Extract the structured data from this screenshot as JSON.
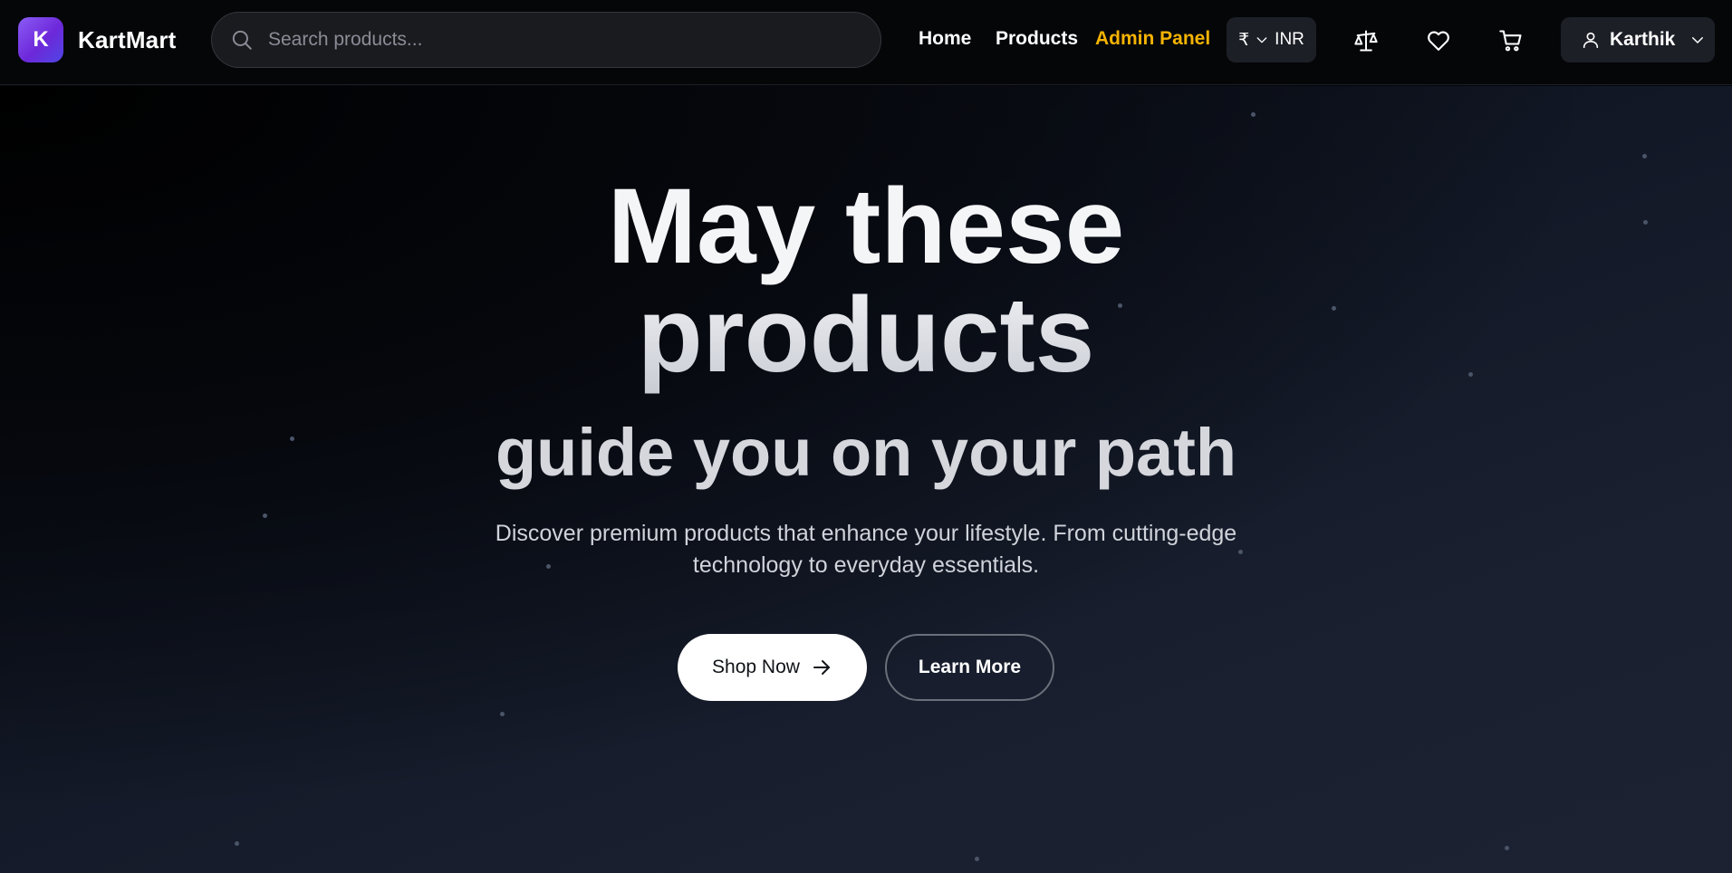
{
  "brand": {
    "logo_letter": "K",
    "name": "KartMart",
    "accent": "#7c3aed"
  },
  "search": {
    "placeholder": "Search products...",
    "value": "",
    "icon": "search-icon"
  },
  "nav": {
    "links": [
      {
        "label": "Home"
      },
      {
        "label": "Products"
      },
      {
        "label": "Admin Panel",
        "color": "#f5b301"
      }
    ]
  },
  "currency": {
    "symbol": "₹",
    "code": "INR"
  },
  "header_icons": [
    "compare-scale-icon",
    "heart-icon",
    "cart-icon"
  ],
  "user": {
    "name": "Karthik",
    "icon": "user-icon"
  },
  "hero": {
    "line1": "May these",
    "line2": "products",
    "line3": "guide you on your path",
    "subtitle_line1": "Discover premium products that enhance your lifestyle. From cutting-edge",
    "subtitle_line2": "technology to everyday essentials.",
    "primary_button": "Shop Now",
    "secondary_button": "Learn More"
  },
  "colors": {
    "background": "#05060a",
    "hero_end": "#1c2232",
    "admin_link": "#f5b301"
  }
}
